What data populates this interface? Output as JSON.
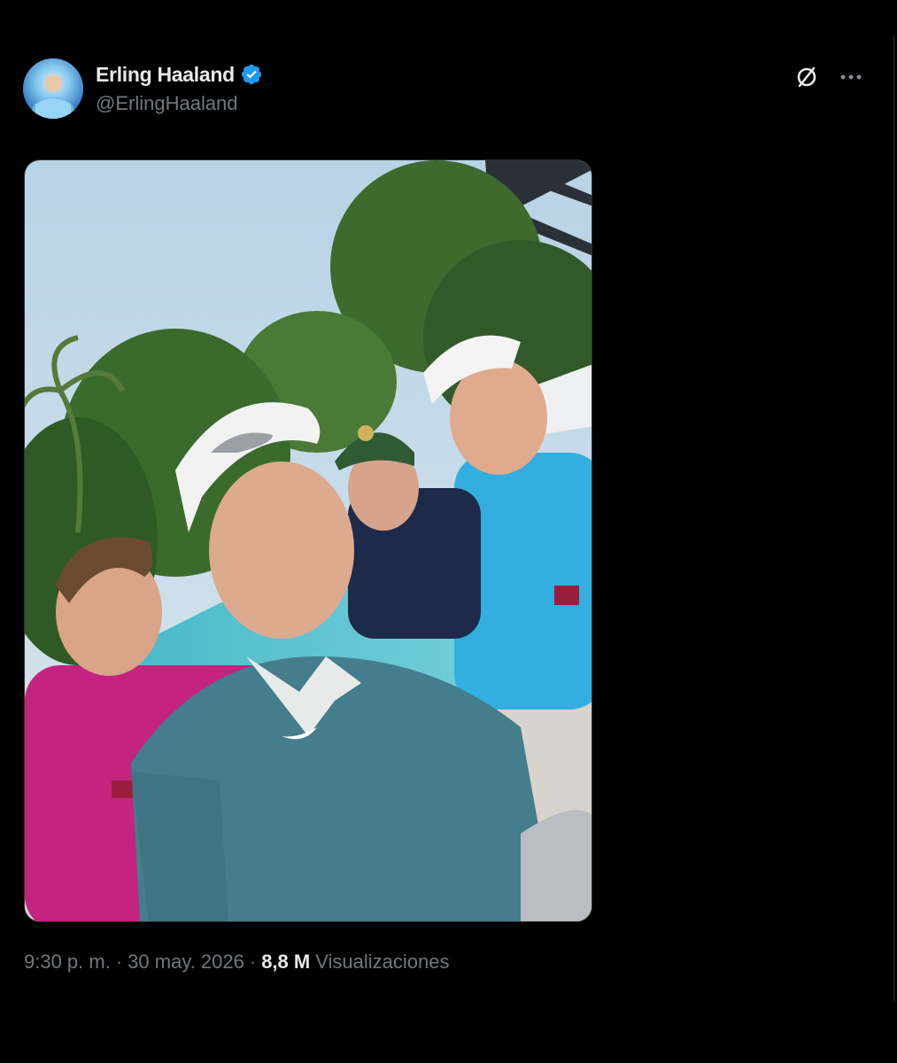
{
  "tweet": {
    "author": {
      "display_name": "Erling Haaland",
      "handle": "@ErlingHaaland",
      "verified": true,
      "verified_color": "#1d9bf0"
    },
    "meta": {
      "time": "9:30 p. m.",
      "separator": "·",
      "date": "30 may. 2026",
      "views_count": "8,8 M",
      "views_label": "Visualizaciones"
    },
    "media": {
      "icon": "photo"
    }
  },
  "icons": {
    "grok": "slashed-circle-icon",
    "more": "more-dots-icon",
    "verified": "verified-badge-icon"
  },
  "colors": {
    "background": "#000000",
    "primary_text": "#e7e9ea",
    "secondary_text": "#71767b",
    "accent": "#1d9bf0"
  }
}
